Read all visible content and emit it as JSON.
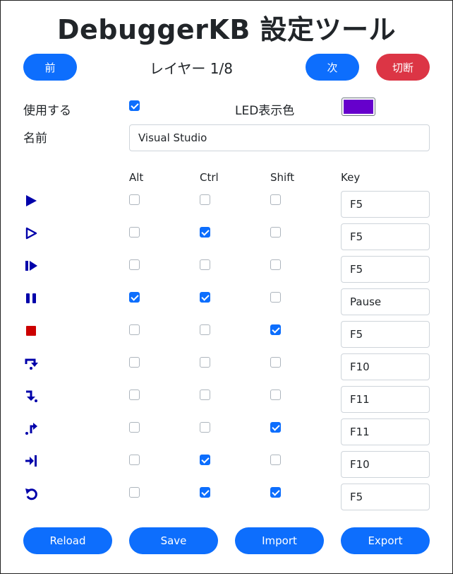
{
  "title": "DebuggerKB 設定ツール",
  "nav": {
    "prev_label": "前",
    "layer_label": "レイヤー 1/8",
    "next_label": "次",
    "disconnect_label": "切断"
  },
  "settings": {
    "use_label": "使用する",
    "use_checked": true,
    "led_label": "LED表示色",
    "led_color": "#6600cc",
    "name_label": "名前",
    "name_value": "Visual Studio"
  },
  "columns": {
    "alt": "Alt",
    "ctrl": "Ctrl",
    "shift": "Shift",
    "key": "Key"
  },
  "rows": [
    {
      "icon": "play-icon",
      "alt": false,
      "ctrl": false,
      "shift": false,
      "key": "F5"
    },
    {
      "icon": "play-outline-icon",
      "alt": false,
      "ctrl": true,
      "shift": false,
      "key": "F5"
    },
    {
      "icon": "continue-icon",
      "alt": false,
      "ctrl": false,
      "shift": false,
      "key": "F5"
    },
    {
      "icon": "pause-icon",
      "alt": true,
      "ctrl": true,
      "shift": false,
      "key": "Pause"
    },
    {
      "icon": "stop-icon",
      "alt": false,
      "ctrl": false,
      "shift": true,
      "key": "F5"
    },
    {
      "icon": "step-over-icon",
      "alt": false,
      "ctrl": false,
      "shift": false,
      "key": "F10"
    },
    {
      "icon": "step-into-icon",
      "alt": false,
      "ctrl": false,
      "shift": false,
      "key": "F11"
    },
    {
      "icon": "step-out-icon",
      "alt": false,
      "ctrl": false,
      "shift": true,
      "key": "F11"
    },
    {
      "icon": "run-to-cursor-icon",
      "alt": false,
      "ctrl": true,
      "shift": false,
      "key": "F10"
    },
    {
      "icon": "restart-icon",
      "alt": false,
      "ctrl": true,
      "shift": true,
      "key": "F5"
    }
  ],
  "footer": {
    "reload_label": "Reload",
    "save_label": "Save",
    "import_label": "Import",
    "export_label": "Export"
  },
  "colors": {
    "accent": "#0d6efd",
    "danger": "#dc3545",
    "icon": "#0000aa",
    "stop": "#cc0000"
  }
}
